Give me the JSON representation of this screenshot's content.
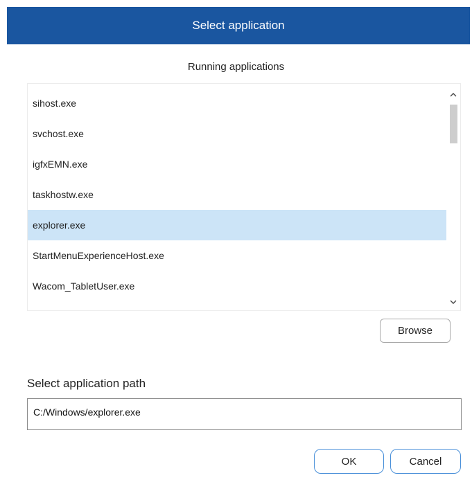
{
  "window": {
    "title": "Select application"
  },
  "running_apps": {
    "heading": "Running applications",
    "items": [
      {
        "label": "sihost.exe",
        "selected": false
      },
      {
        "label": "svchost.exe",
        "selected": false
      },
      {
        "label": "igfxEMN.exe",
        "selected": false
      },
      {
        "label": "taskhostw.exe",
        "selected": false
      },
      {
        "label": "explorer.exe",
        "selected": true
      },
      {
        "label": "StartMenuExperienceHost.exe",
        "selected": false
      },
      {
        "label": "Wacom_TabletUser.exe",
        "selected": false
      }
    ],
    "scrollbar_icons": {
      "up": "chevron-up-icon",
      "down": "chevron-down-icon"
    }
  },
  "browse": {
    "label": "Browse"
  },
  "path": {
    "label": "Select application path",
    "value": "C:/Windows/explorer.exe"
  },
  "actions": {
    "ok_label": "OK",
    "cancel_label": "Cancel"
  },
  "colors": {
    "titlebar": "#1a56a0",
    "selection": "#cce4f7",
    "button_border_accent": "#4a90d9"
  }
}
